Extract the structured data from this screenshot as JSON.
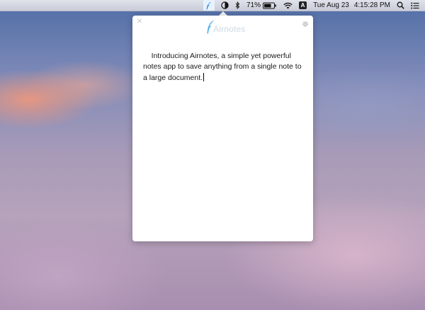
{
  "menubar": {
    "battery_percent": "71%",
    "input_source": "A",
    "date": "Tue Aug 23",
    "time": "4:15:28 PM",
    "icons": [
      "airnotes-icon",
      "night-shift-icon",
      "bluetooth-icon",
      "battery-icon",
      "wifi-icon",
      "input-source-icon",
      "spotlight-icon",
      "notification-center-icon"
    ]
  },
  "popover": {
    "app_name": "Airnotes",
    "note_text": "Introducing Airnotes, a simple yet powerful notes app to save anything from a single note to a large document."
  },
  "colors": {
    "logo_feather": "#5ab0e8",
    "logo_text": "#cfd9e4",
    "menubar_bg": "#e2e2e8"
  }
}
